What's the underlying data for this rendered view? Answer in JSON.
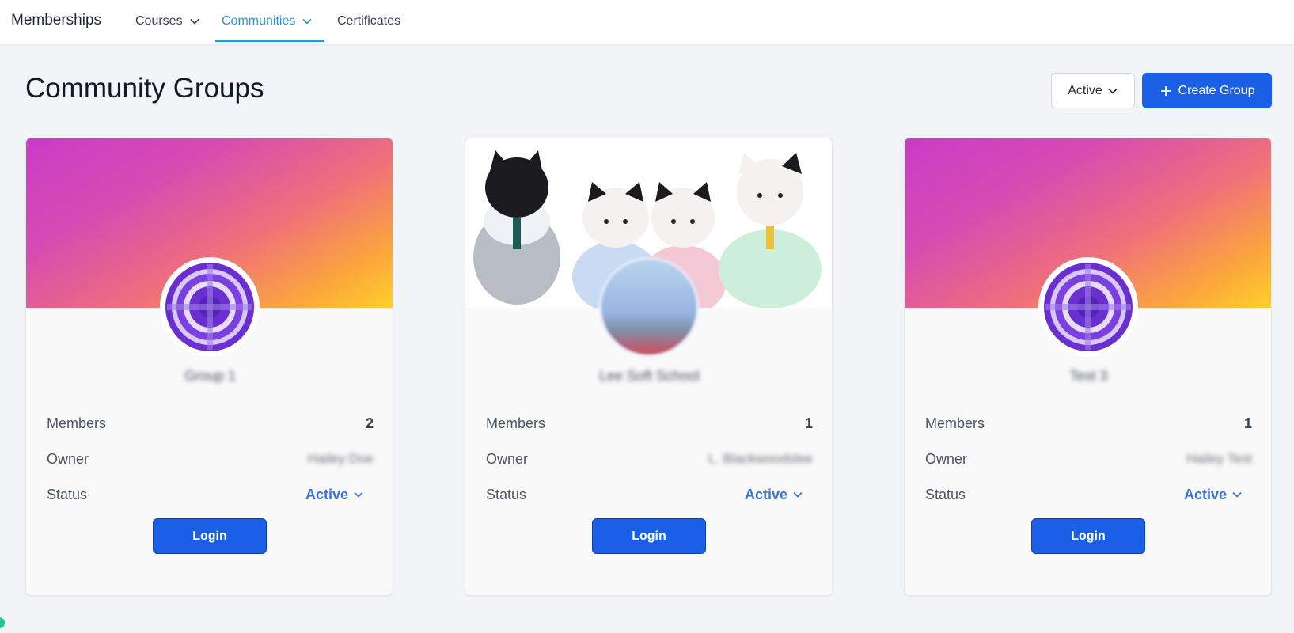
{
  "nav": {
    "brand": "Memberships",
    "items": [
      {
        "label": "Courses",
        "has_dropdown": true,
        "active": false
      },
      {
        "label": "Communities",
        "has_dropdown": true,
        "active": true
      },
      {
        "label": "Certificates",
        "has_dropdown": false,
        "active": false
      }
    ],
    "accent_color": "#2c97c8"
  },
  "header": {
    "title": "Community Groups",
    "filter_label": "Active",
    "create_button_label": "Create Group",
    "primary_color": "#1a5fe6"
  },
  "cards": [
    {
      "name": "Group 1",
      "banner": "gradient",
      "avatar": "cross-stitch-logo-icon",
      "members_label": "Members",
      "members_count": "2",
      "owner_label": "Owner",
      "owner_name": "Hailey Doe",
      "status_label": "Status",
      "status_value": "Active",
      "login_label": "Login"
    },
    {
      "name": "Lee Soft School",
      "banner": "photo",
      "avatar": "profile-photo",
      "members_label": "Members",
      "members_count": "1",
      "owner_label": "Owner",
      "owner_name": "L. Blackwoodslee",
      "status_label": "Status",
      "status_value": "Active",
      "login_label": "Login"
    },
    {
      "name": "Test 3",
      "banner": "gradient",
      "avatar": "cross-stitch-logo-icon",
      "members_label": "Members",
      "members_count": "1",
      "owner_label": "Owner",
      "owner_name": "Hailey Test",
      "status_label": "Status",
      "status_value": "Active",
      "login_label": "Login"
    }
  ]
}
